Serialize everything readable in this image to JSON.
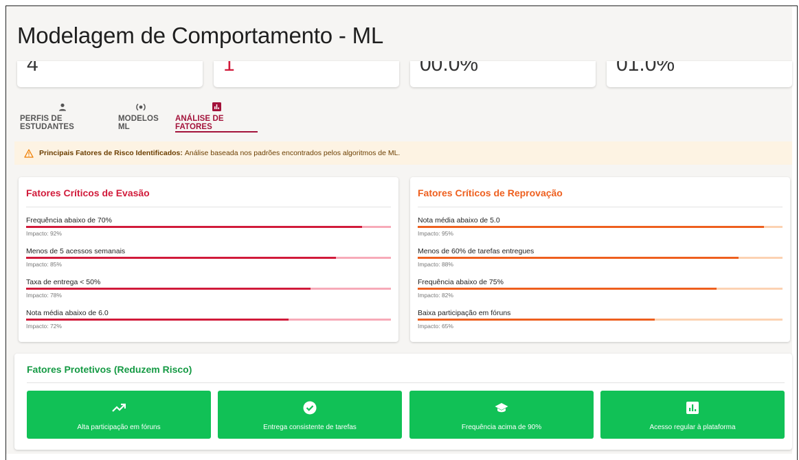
{
  "page": {
    "title": "Modelagem de Comportamento - ML"
  },
  "stats": [
    {
      "value": "4",
      "color": "#333333"
    },
    {
      "value": "1",
      "color": "#d11a3a"
    },
    {
      "value": "00.0%",
      "color": "#333333"
    },
    {
      "value": "01.0%",
      "color": "#333333"
    }
  ],
  "tabs": [
    {
      "label": "PERFIS DE ESTUDANTES",
      "icon": "person-icon",
      "active": false
    },
    {
      "label": "MODELOS ML",
      "icon": "model-icon",
      "active": false
    },
    {
      "label": "ANÁLISE DE FATORES",
      "icon": "analytics-icon",
      "active": true
    }
  ],
  "alert": {
    "icon": "warning-icon",
    "bold": "Principais Fatores de Risco Identificados:",
    "text": "Análise baseada nos padrões encontrados pelos algoritmos de ML."
  },
  "evasao": {
    "title": "Fatores Críticos de Evasão",
    "accent": "#d11a3a",
    "factors": [
      {
        "label": "Frequência abaixo de 70%",
        "impact": "Impacto: 92%",
        "value": 92
      },
      {
        "label": "Menos de 5 acessos semanais",
        "impact": "Impacto: 85%",
        "value": 85
      },
      {
        "label": "Taxa de entrega < 50%",
        "impact": "Impacto: 78%",
        "value": 78
      },
      {
        "label": "Nota média abaixo de 6.0",
        "impact": "Impacto: 72%",
        "value": 72
      }
    ]
  },
  "reprovacao": {
    "title": "Fatores Críticos de Reprovação",
    "accent": "#ee5f1e",
    "factors": [
      {
        "label": "Nota média abaixo de 5.0",
        "impact": "Impacto: 95%",
        "value": 95
      },
      {
        "label": "Menos de 60% de tarefas entregues",
        "impact": "Impacto: 88%",
        "value": 88
      },
      {
        "label": "Frequência abaixo de 75%",
        "impact": "Impacto: 82%",
        "value": 82
      },
      {
        "label": "Baixa participação em fóruns",
        "impact": "Impacto: 65%",
        "value": 65
      }
    ]
  },
  "protetivos": {
    "title": "Fatores Protetivos (Reduzem Risco)",
    "accent": "#11c156",
    "items": [
      {
        "label": "Alta participação em fóruns",
        "icon": "trending-up-icon"
      },
      {
        "label": "Entrega consistente de tarefas",
        "icon": "check-circle-icon"
      },
      {
        "label": "Frequência acima de 90%",
        "icon": "graduation-cap-icon"
      },
      {
        "label": "Acesso regular à plataforma",
        "icon": "bar-chart-icon"
      }
    ]
  }
}
